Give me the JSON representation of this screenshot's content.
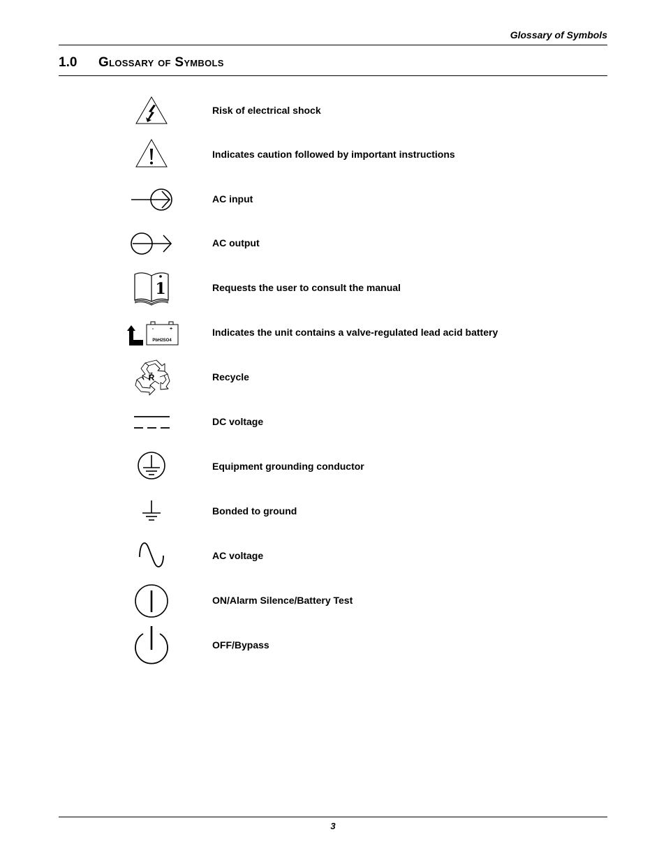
{
  "header": {
    "running_title": "Glossary of Symbols"
  },
  "section": {
    "number": "1.0",
    "title": "Glossary of Symbols"
  },
  "symbols": [
    {
      "icon": "electrical-shock-warning-icon",
      "label": "Risk of electrical shock"
    },
    {
      "icon": "caution-warning-icon",
      "label": "Indicates caution followed by important instructions"
    },
    {
      "icon": "ac-input-icon",
      "label": "AC input"
    },
    {
      "icon": "ac-output-icon",
      "label": "AC output"
    },
    {
      "icon": "consult-manual-icon",
      "label": "Requests the user to consult the manual"
    },
    {
      "icon": "lead-acid-battery-icon",
      "label": "Indicates the unit contains a valve-regulated lead acid battery",
      "battery_text": "PbH2SO4",
      "battery_minus": "-",
      "battery_plus": "+"
    },
    {
      "icon": "recycle-icon",
      "label": "Recycle",
      "recycle_letter": "R"
    },
    {
      "icon": "dc-voltage-icon",
      "label": "DC voltage"
    },
    {
      "icon": "equipment-grounding-icon",
      "label": "Equipment grounding conductor"
    },
    {
      "icon": "bonded-ground-icon",
      "label": "Bonded to ground"
    },
    {
      "icon": "ac-voltage-icon",
      "label": "AC voltage"
    },
    {
      "icon": "on-alarm-silence-icon",
      "label": "ON/Alarm Silence/Battery Test"
    },
    {
      "icon": "off-bypass-icon",
      "label": "OFF/Bypass"
    }
  ],
  "footer": {
    "page_number": "3"
  }
}
